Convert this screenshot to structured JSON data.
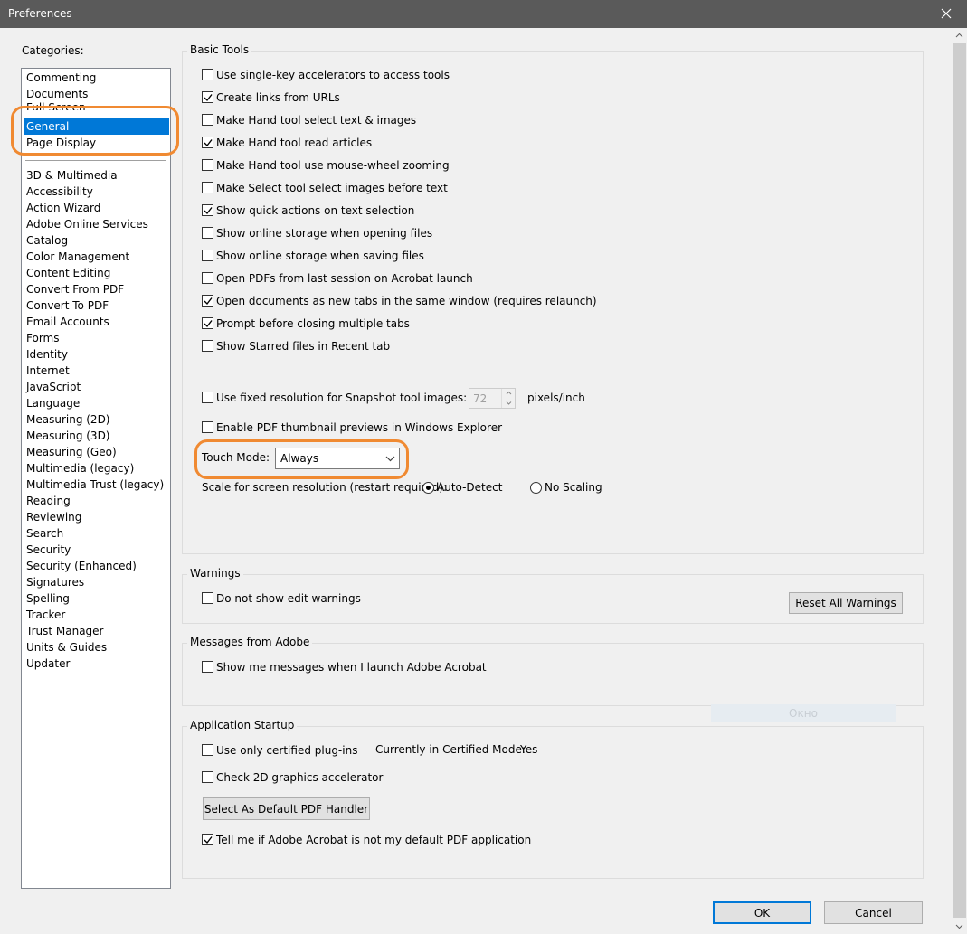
{
  "window": {
    "title": "Preferences"
  },
  "categories": {
    "label": "Categories:",
    "top_items": [
      "Commenting",
      "Documents",
      "Full Screen",
      "General",
      "Page Display"
    ],
    "items": [
      "3D & Multimedia",
      "Accessibility",
      "Action Wizard",
      "Adobe Online Services",
      "Catalog",
      "Color Management",
      "Content Editing",
      "Convert From PDF",
      "Convert To PDF",
      "Email Accounts",
      "Forms",
      "Identity",
      "Internet",
      "JavaScript",
      "Language",
      "Measuring (2D)",
      "Measuring (3D)",
      "Measuring (Geo)",
      "Multimedia (legacy)",
      "Multimedia Trust (legacy)",
      "Reading",
      "Reviewing",
      "Search",
      "Security",
      "Security (Enhanced)",
      "Signatures",
      "Spelling",
      "Tracker",
      "Trust Manager",
      "Units & Guides",
      "Updater"
    ],
    "selected": "General"
  },
  "basic_tools": {
    "title": "Basic Tools",
    "options": [
      {
        "label": "Use single-key accelerators to access tools",
        "checked": false
      },
      {
        "label": "Create links from URLs",
        "checked": true
      },
      {
        "label": "Make Hand tool select text & images",
        "checked": false
      },
      {
        "label": "Make Hand tool read articles",
        "checked": true
      },
      {
        "label": "Make Hand tool use mouse-wheel zooming",
        "checked": false
      },
      {
        "label": "Make Select tool select images before text",
        "checked": false
      },
      {
        "label": "Show quick actions on text selection",
        "checked": true
      },
      {
        "label": "Show online storage when opening files",
        "checked": false
      },
      {
        "label": "Show online storage when saving files",
        "checked": false
      },
      {
        "label": "Open PDFs from last session on Acrobat launch",
        "checked": false
      },
      {
        "label": "Open documents as new tabs in the same window (requires relaunch)",
        "checked": true
      },
      {
        "label": "Prompt before closing multiple tabs",
        "checked": true
      },
      {
        "label": "Show Starred files in Recent tab",
        "checked": false
      }
    ],
    "snapshot": {
      "label": "Use fixed resolution for Snapshot tool images:",
      "checked": false,
      "value": "72",
      "unit": "pixels/inch"
    },
    "thumbnail": {
      "label": "Enable PDF thumbnail previews in Windows Explorer",
      "checked": false
    },
    "touch_mode": {
      "label": "Touch Mode:",
      "value": "Always"
    },
    "scale": {
      "label": "Scale for screen resolution (restart required):",
      "auto_detect": "Auto-Detect",
      "no_scaling": "No Scaling",
      "selected": "Auto-Detect"
    }
  },
  "warnings": {
    "title": "Warnings",
    "option": {
      "label": "Do not show edit warnings",
      "checked": false
    },
    "reset_button": "Reset All Warnings"
  },
  "messages": {
    "title": "Messages from Adobe",
    "option": {
      "label": "Show me messages when I launch Adobe Acrobat",
      "checked": false
    },
    "ghost_text": "Окно"
  },
  "startup": {
    "title": "Application Startup",
    "certified": {
      "label": "Use only certified plug-ins",
      "checked": false
    },
    "certified_mode_label": "Currently in Certified Mode:",
    "certified_mode_value": "Yes",
    "graphics": {
      "label": "Check 2D graphics accelerator",
      "checked": false
    },
    "default_handler_button": "Select As Default PDF Handler",
    "tell_me": {
      "label": "Tell me if Adobe Acrobat is not my default PDF application",
      "checked": true
    }
  },
  "footer": {
    "ok": "OK",
    "cancel": "Cancel"
  },
  "colors": {
    "selection": "#0078d7",
    "annotation": "#f08a32",
    "titlebar": "#5a5a5a"
  }
}
